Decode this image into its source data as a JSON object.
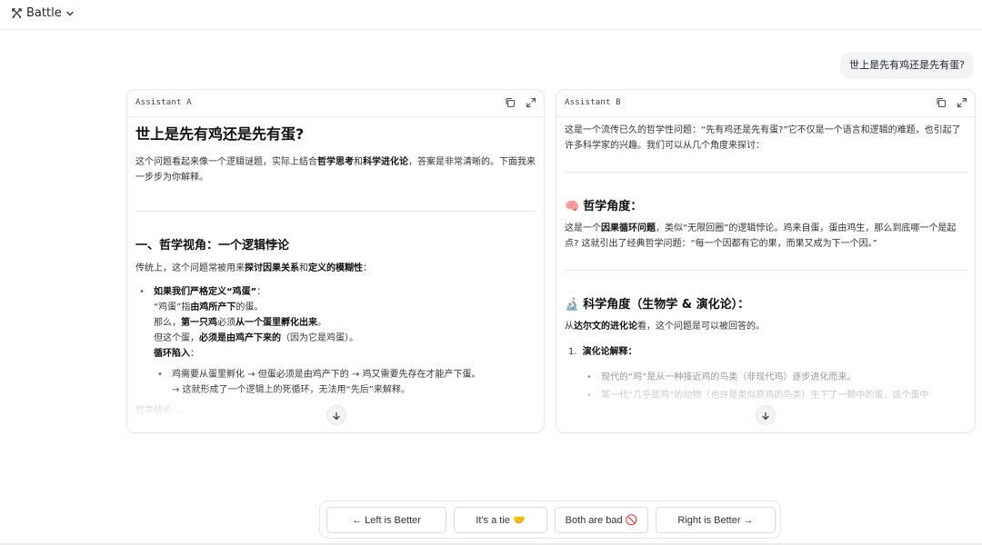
{
  "header": {
    "brand": "Battle",
    "brand_icon": "crossed-swords-icon",
    "menu_icon": "chevron-down-icon"
  },
  "prompt": "世上是先有鸡还是先有蛋?",
  "assistant_a": {
    "label": "Assistant A",
    "title": "世上是先有鸡还是先有蛋?",
    "intro": [
      {
        "t": "这个问题看起来像一个逻辑谜题，实际上结合"
      },
      {
        "t": "哲学思考",
        "b": true
      },
      {
        "t": "和"
      },
      {
        "t": "科学进化论",
        "b": true
      },
      {
        "t": "，答案是非常清晰的。下面我来一步步为你解释。"
      }
    ],
    "section1_title": "一、哲学视角：一个逻辑悖论",
    "section1_lead": [
      {
        "t": "传统上，这个问题常被用来"
      },
      {
        "t": "探讨因果关系",
        "b": true
      },
      {
        "t": "和"
      },
      {
        "t": "定义的模糊性",
        "b": true
      },
      {
        "t": "："
      }
    ],
    "bullet_title": [
      {
        "t": "如果我们严格定义“鸡蛋”",
        "b": true
      },
      {
        "t": "："
      }
    ],
    "bullet_lines": [
      [
        {
          "t": "“鸡蛋”指"
        },
        {
          "t": "由鸡所产下",
          "b": true
        },
        {
          "t": "的蛋。"
        }
      ],
      [
        {
          "t": "那么，"
        },
        {
          "t": "第一只鸡",
          "b": true
        },
        {
          "t": "必须"
        },
        {
          "t": "从一个蛋里孵化出来",
          "b": true
        },
        {
          "t": "。"
        }
      ],
      [
        {
          "t": "但这个蛋，"
        },
        {
          "t": "必须是由鸡产下来的",
          "b": true
        },
        {
          "t": "（因为它是鸡蛋）。"
        }
      ],
      [
        {
          "t": "循环陷入",
          "b": true
        },
        {
          "t": "："
        }
      ]
    ],
    "sub_lines": [
      "鸡需要从蛋里孵化 → 但蛋必须是由鸡产下的 → 鸡又需要先存在才能产下蛋。",
      "→ 这就形成了一个逻辑上的死循环，无法用“先后”来解释。"
    ],
    "faded_line": "哲学结论…"
  },
  "assistant_b": {
    "label": "Assistant B",
    "intro": "这是一个流传已久的哲学性问题：“先有鸡还是先有蛋?”它不仅是一个语言和逻辑的难题，也引起了许多科学家的兴趣。我们可以从几个角度来探讨：",
    "section1_emoji": "🧠",
    "section1_title": "哲学角度：",
    "section1_text": [
      {
        "t": "这是一个"
      },
      {
        "t": "因果循环问题",
        "b": true
      },
      {
        "t": "，类似“无限回圈”的逻辑悖论。鸡来自蛋，蛋由鸡生，那么到底哪一个是起点? 这就引出了经典哲学问题：“每一个因都有它的果，而果又成为下一个因。”"
      }
    ],
    "section2_emoji": "🔬",
    "section2_title": "科学角度（生物学 & 演化论）：",
    "section2_lead": [
      {
        "t": "从"
      },
      {
        "t": "达尔文的进化论",
        "b": true
      },
      {
        "t": "看，这个问题是可以被回答的。"
      }
    ],
    "list_num": "1.",
    "list_title": "演化论解释：",
    "faded_bullets": [
      "现代的“鸡”是从一种接近鸡的鸟类（非现代鸡）逐步进化而来。",
      "某一代“几乎是鸡”的动物（也许是类似原鸡的鸟类）生下了一颗中的蛋，这个蛋中"
    ]
  },
  "icons": {
    "copy": "copy-icon",
    "expand": "expand-icon",
    "scroll": "arrow-down-icon"
  },
  "votes": {
    "left": "← Left is Better",
    "tie": "It's a tie 🤝",
    "bad": "Both are bad 🚫",
    "right": "Right is Better →"
  }
}
